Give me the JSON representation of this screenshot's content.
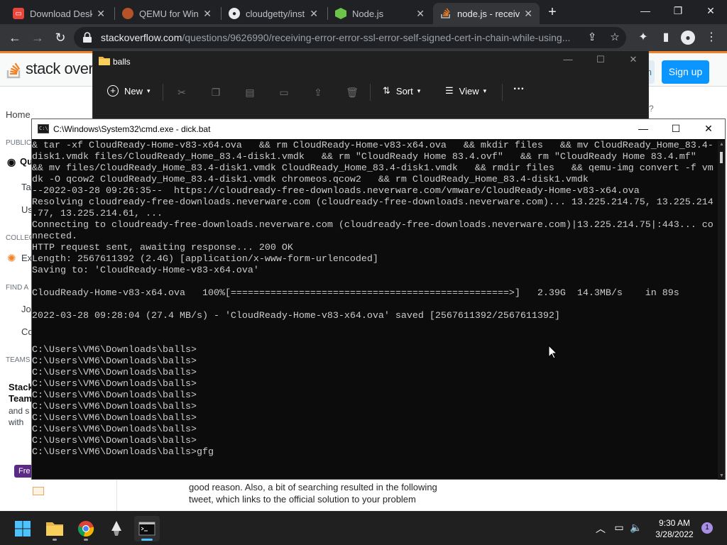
{
  "browser": {
    "tabs": [
      {
        "title": "Download Desk",
        "favicon": "download-favicon",
        "color": "#e8453c"
      },
      {
        "title": "QEMU for Wind",
        "favicon": "qemu-favicon",
        "color": "#b4532a"
      },
      {
        "title": "cloudgetty/inst",
        "favicon": "github-favicon",
        "color": "#e8eaed"
      },
      {
        "title": "Node.js",
        "favicon": "nodejs-favicon",
        "color": "#6cc24a"
      },
      {
        "title": "node.js - receivi",
        "favicon": "stackoverflow-favicon",
        "color": "#f48024"
      }
    ],
    "url_host": "stackoverflow.com",
    "url_path": "/questions/9626990/receiving-error-error-ssl-error-self-signed-cert-in-chain-while-using..."
  },
  "stackoverflow": {
    "logo_text": "stack overflow",
    "signup_label": "Sign up",
    "login_fragment": "n",
    "sidebar": {
      "home": "Home",
      "public_heading": "PUBLIC",
      "questions": "Qu",
      "tags": "Ta",
      "users": "Us",
      "collectives_heading": "COLLEC",
      "explore": "Ex",
      "find_heading": "FIND A",
      "jobs": "Jo",
      "companies": "Co",
      "teams_heading": "TEAMS",
      "teams_title_1": "Stack",
      "teams_title_2": "Team",
      "teams_text_1": "and s",
      "teams_text_2": "with",
      "free_label": "Fre"
    },
    "answer_lines": [
      "good reason. Also, a bit of searching resulted in the following",
      "tweet, which links to the official solution to your problem"
    ],
    "question_mark": "?"
  },
  "explorer": {
    "title": "balls",
    "new_label": "New",
    "sort_label": "Sort",
    "view_label": "View",
    "more_label": "···"
  },
  "cmd": {
    "title": "C:\\Windows\\System32\\cmd.exe - dick.bat",
    "lines": [
      "& tar -xf CloudReady-Home-v83-x64.ova   && rm CloudReady-Home-v83-x64.ova   && mkdir files   && mv CloudReady_Home_83.4-",
      "disk1.vmdk files/CloudReady_Home_83.4-disk1.vmdk   && rm \"CloudReady Home 83.4.ovf\"   && rm \"CloudReady Home 83.4.mf\"",
      "&& mv files/CloudReady_Home_83.4-disk1.vmdk CloudReady_Home_83.4-disk1.vmdk   && rmdir files   && qemu-img convert -f vm",
      "dk -O qcow2 CloudReady_Home_83.4-disk1.vmdk chromeos.qcow2   && rm CloudReady_Home_83.4-disk1.vmdk",
      "--2022-03-28 09:26:35--  https://cloudready-free-downloads.neverware.com/vmware/CloudReady-Home-v83-x64.ova",
      "Resolving cloudready-free-downloads.neverware.com (cloudready-free-downloads.neverware.com)... 13.225.214.75, 13.225.214",
      ".77, 13.225.214.61, ...",
      "Connecting to cloudready-free-downloads.neverware.com (cloudready-free-downloads.neverware.com)|13.225.214.75|:443... co",
      "nnected.",
      "HTTP request sent, awaiting response... 200 OK",
      "Length: 2567611392 (2.4G) [application/x-www-form-urlencoded]",
      "Saving to: 'CloudReady-Home-v83-x64.ova'",
      "",
      "CloudReady-Home-v83-x64.ova   100%[=================================================>]   2.39G  14.3MB/s    in 89s",
      "",
      "2022-03-28 09:28:04 (27.4 MB/s) - 'CloudReady-Home-v83-x64.ova' saved [2567611392/2567611392]",
      "",
      "",
      "C:\\Users\\VM6\\Downloads\\balls>",
      "C:\\Users\\VM6\\Downloads\\balls>",
      "C:\\Users\\VM6\\Downloads\\balls>",
      "C:\\Users\\VM6\\Downloads\\balls>",
      "C:\\Users\\VM6\\Downloads\\balls>",
      "C:\\Users\\VM6\\Downloads\\balls>",
      "C:\\Users\\VM6\\Downloads\\balls>",
      "C:\\Users\\VM6\\Downloads\\balls>",
      "C:\\Users\\VM6\\Downloads\\balls>",
      "C:\\Users\\VM6\\Downloads\\balls>gfg"
    ]
  },
  "taskbar": {
    "apps": [
      "start-button",
      "file-explorer",
      "chrome",
      "inkscape",
      "terminal"
    ],
    "time": "9:30 AM",
    "date": "3/28/2022",
    "notification_count": "1"
  }
}
